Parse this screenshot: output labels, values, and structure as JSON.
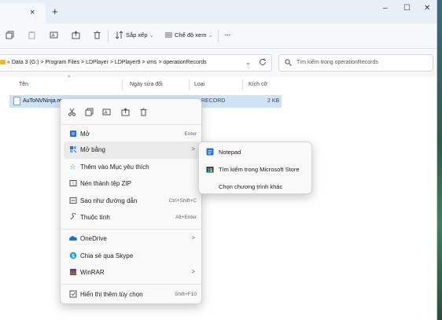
{
  "window": {
    "tab_close": "×",
    "new_tab": "+",
    "minimize": "–",
    "maximize": "☐",
    "close": "✕"
  },
  "toolbar": {
    "sort_label": "Sắp xếp",
    "view_label": "Chế độ xem",
    "more": "···"
  },
  "address": {
    "overflow": "«",
    "crumbs": [
      "Data 3 (G:)",
      "Program Files",
      "LDPlayer",
      "LDPlayer9",
      "vms",
      "operationRecords"
    ],
    "separator": ">",
    "search_placeholder": "Tìm kiếm trong operationRecords"
  },
  "columns": {
    "name": "Tên",
    "date": "Ngày sửa đổi",
    "type": "Loại",
    "size": "Kích cỡ"
  },
  "file": {
    "name": "AuToNVNinja.re",
    "type": "RECORD",
    "size": "2 KB"
  },
  "context_menu": {
    "items": [
      {
        "label": "Mở",
        "shortcut": "Enter",
        "icon": "notepad-icon"
      },
      {
        "label": "Mở bằng",
        "shortcut": "",
        "icon": "open-with-icon",
        "arrow": ">"
      },
      {
        "label": "Thêm vào Mục yêu thích",
        "shortcut": "",
        "icon": "star-icon"
      },
      {
        "label": "Nén thành tệp ZIP",
        "shortcut": "",
        "icon": "zip-icon"
      },
      {
        "label": "Sao như đường dẫn",
        "shortcut": "Ctrl+Shift+C",
        "icon": "copy-path-icon"
      },
      {
        "label": "Thuộc tính",
        "shortcut": "Alt+Enter",
        "icon": "wrench-icon"
      },
      {
        "label": "OneDrive",
        "shortcut": "",
        "icon": "onedrive-icon",
        "arrow": ">"
      },
      {
        "label": "Chia sẻ qua Skype",
        "shortcut": "",
        "icon": "skype-icon"
      },
      {
        "label": "WinRAR",
        "shortcut": "",
        "icon": "winrar-icon",
        "arrow": ">"
      },
      {
        "label": "Hiển thị thêm tùy chọn",
        "shortcut": "Shift+F10",
        "icon": "more-options-icon"
      }
    ]
  },
  "submenu": {
    "items": [
      {
        "label": "Notepad",
        "icon": "notepad-icon"
      },
      {
        "label": "Tìm kiếm trong Microsoft Store",
        "icon": "store-icon"
      },
      {
        "label": "Chọn chương trình khác",
        "icon": ""
      }
    ]
  },
  "colors": {
    "selection": "#cfe3f7",
    "accent": "#3b6fb6",
    "menu_bg": "#f9f9f9"
  }
}
